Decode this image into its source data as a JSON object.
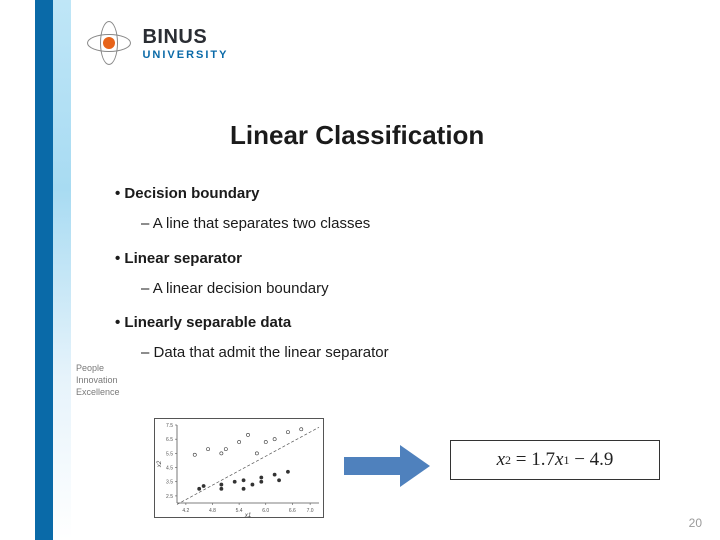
{
  "brand": {
    "name": "BINUS",
    "sub": "UNIVERSITY"
  },
  "title": "Linear Classification",
  "bullets": [
    {
      "heading": "Decision boundary",
      "sub": "A line that separates two classes"
    },
    {
      "heading": "Linear separator",
      "sub": "A linear decision boundary"
    },
    {
      "heading": "Linearly separable data",
      "sub": "Data that admit the linear separator"
    }
  ],
  "tagline": [
    "People",
    "Innovation",
    "Excellence"
  ],
  "equation": {
    "lhs_var": "x",
    "lhs_sub": "2",
    "eq": "=",
    "slope": "1.7",
    "rhs_var": "x",
    "rhs_sub": "1",
    "minus": "−",
    "intercept": "4.9"
  },
  "page_number": "20",
  "chart_data": {
    "type": "scatter",
    "title": "",
    "xlabel": "x1",
    "ylabel": "x2",
    "xlim": [
      4.0,
      7.2
    ],
    "ylim": [
      2.0,
      7.5
    ],
    "x_ticks": [
      4.2,
      4.8,
      5.4,
      6.0,
      6.6,
      7.0
    ],
    "y_ticks": [
      2.5,
      3.5,
      4.5,
      5.5,
      6.5,
      7.5
    ],
    "series": [
      {
        "name": "class_filled",
        "marker": "filled-circle",
        "points": [
          [
            4.5,
            3.0
          ],
          [
            4.6,
            3.2
          ],
          [
            5.0,
            3.3
          ],
          [
            5.0,
            3.0
          ],
          [
            5.3,
            3.5
          ],
          [
            5.5,
            3.6
          ],
          [
            5.5,
            3.0
          ],
          [
            5.7,
            3.3
          ],
          [
            5.9,
            3.8
          ],
          [
            5.9,
            3.5
          ],
          [
            6.2,
            4.0
          ],
          [
            6.3,
            3.6
          ],
          [
            6.5,
            4.2
          ]
        ]
      },
      {
        "name": "class_open",
        "marker": "open-circle",
        "points": [
          [
            4.4,
            5.4
          ],
          [
            4.7,
            5.8
          ],
          [
            5.0,
            5.5
          ],
          [
            5.1,
            5.8
          ],
          [
            5.4,
            6.3
          ],
          [
            5.6,
            6.8
          ],
          [
            5.8,
            5.5
          ],
          [
            6.0,
            6.3
          ],
          [
            6.2,
            6.5
          ],
          [
            6.5,
            7.0
          ],
          [
            6.8,
            7.2
          ]
        ]
      }
    ],
    "separator_line": {
      "slope": 1.7,
      "intercept": -4.9,
      "style": "dashed"
    }
  }
}
